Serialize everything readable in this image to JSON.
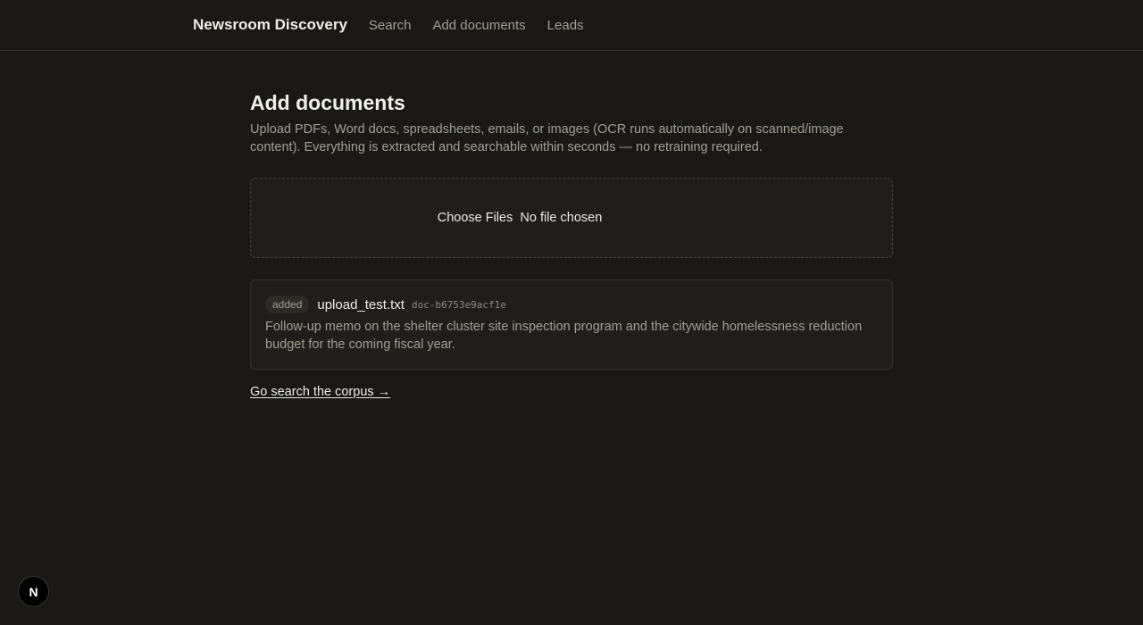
{
  "nav": {
    "brand": "Newsroom Discovery",
    "links": [
      "Search",
      "Add documents",
      "Leads"
    ]
  },
  "page": {
    "title": "Add documents",
    "description": "Upload PDFs, Word docs, spreadsheets, emails, or images (OCR runs automatically on scanned/image content). Everything is extracted and searchable within seconds — no retraining required."
  },
  "file_input": {
    "button_label": "Choose Files",
    "status": "No file chosen"
  },
  "results": [
    {
      "badge": "added",
      "filename": "upload_test.txt",
      "doc_id": "doc-b6753e9acf1e",
      "summary": "Follow-up memo on the shelter cluster site inspection program and the citywide homelessness reduction budget for the coming fiscal year."
    }
  ],
  "search_link": "Go search the corpus →",
  "dev_badge": {
    "letter": "N",
    "icon": "nextjs-icon"
  },
  "colors": {
    "background": "#1a1815",
    "surface": "#201e1b",
    "border": "#34312c",
    "text": "#ece9e3",
    "muted": "#a39e95"
  }
}
